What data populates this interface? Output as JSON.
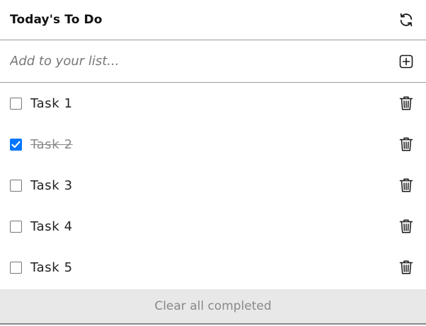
{
  "header": {
    "title": "Today's To Do",
    "refresh_icon": "refresh-icon"
  },
  "add_row": {
    "placeholder": "Add to your list...",
    "value": "",
    "add_icon": "plus-square-icon"
  },
  "tasks": [
    {
      "label": "Task 1",
      "completed": false
    },
    {
      "label": "Task 2",
      "completed": true
    },
    {
      "label": "Task 3",
      "completed": false
    },
    {
      "label": "Task 4",
      "completed": false
    },
    {
      "label": "Task 5",
      "completed": false
    }
  ],
  "task_icons": {
    "checkmark": "checkmark-icon",
    "delete": "trash-icon"
  },
  "footer": {
    "clear_label": "Clear all completed"
  },
  "colors": {
    "checkbox_checked": "#0075ff",
    "completed_text": "#888888",
    "clear_bg": "#e8e8e8",
    "divider": "#9a9a9a"
  }
}
